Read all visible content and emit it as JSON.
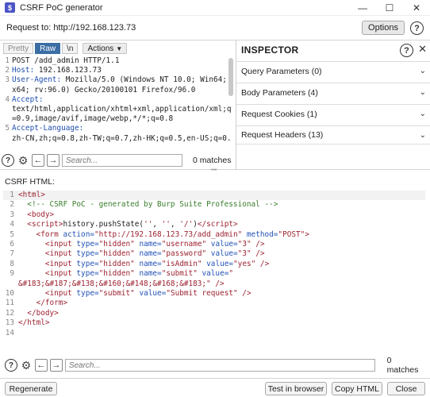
{
  "window": {
    "title": "CSRF PoC generator",
    "icon": "burp-logo-icon",
    "controls": [
      "minimize-icon",
      "maximize-icon",
      "close-icon"
    ]
  },
  "request_bar": {
    "label": "Request to: http://192.168.123.73",
    "options_label": "Options",
    "help_label": "?"
  },
  "request_editor": {
    "tabs": [
      {
        "label": "Pretty",
        "active": false
      },
      {
        "label": "Raw",
        "active": true
      },
      {
        "label": "\\n",
        "active": false
      }
    ],
    "actions_label": "Actions",
    "lines": [
      {
        "num": "1",
        "text": "POST /add_admin HTTP/1.1",
        "key": ""
      },
      {
        "num": "2",
        "text": " 192.168.123.73",
        "key": "Host:"
      },
      {
        "num": "3",
        "text": " Mozilla/5.0 (Windows NT 10.0; Win64;",
        "key": "User-Agent:"
      },
      {
        "num": "",
        "text": "x64; rv:96.0) Gecko/20100101 Firefox/96.0",
        "key": ""
      },
      {
        "num": "4",
        "text": "",
        "key": "Accept:"
      },
      {
        "num": "",
        "text": "text/html,application/xhtml+xml,application/xml;q",
        "key": ""
      },
      {
        "num": "",
        "text": "=0.9,image/avif,image/webp,*/*;q=0.8",
        "key": ""
      },
      {
        "num": "5",
        "text": "",
        "key": "Accept-Language:"
      },
      {
        "num": "",
        "text": "zh-CN,zh;q=0.8,zh-TW;q=0.7,zh-HK;q=0.5,en-US;q=0.",
        "key": ""
      }
    ],
    "search_placeholder": "Search...",
    "matches": "0 matches"
  },
  "inspector": {
    "title": "INSPECTOR",
    "sections": [
      {
        "label": "Query Parameters (0)"
      },
      {
        "label": "Body Parameters (4)"
      },
      {
        "label": "Request Cookies (1)"
      },
      {
        "label": "Request Headers (13)"
      }
    ]
  },
  "csrf": {
    "label": "CSRF HTML:",
    "lines": [
      "1",
      "2",
      "3",
      "4",
      "5",
      "6",
      "7",
      "8",
      "9",
      "",
      "10",
      "11",
      "12",
      "13",
      "14"
    ],
    "search_placeholder": "Search...",
    "matches": "0 matches"
  },
  "footer": {
    "regenerate": "Regenerate",
    "test_in_browser": "Test in browser",
    "copy_html": "Copy HTML",
    "close": "Close"
  }
}
